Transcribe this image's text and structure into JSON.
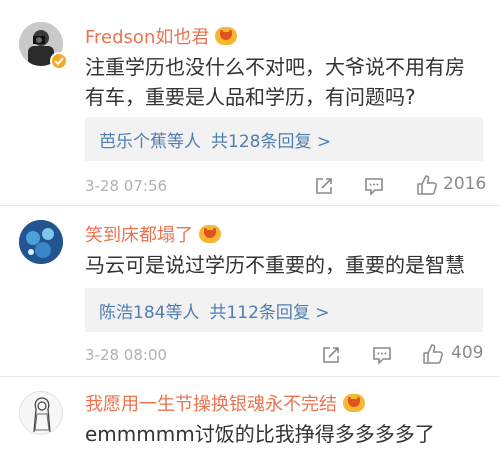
{
  "comments": [
    {
      "username": "Fredson如也君",
      "lines": [
        "注重学历也没什么不对吧，大爷说不用有房",
        "有车，重要是人品和学历，有问题吗?"
      ],
      "reply_names": "芭乐个蕉等人",
      "reply_count": "共128条回复 >",
      "time": "3-28 07:56",
      "likes": "2016",
      "verified": true
    },
    {
      "username": "笑到床都塌了",
      "lines": [
        "马云可是说过学历不重要的，重要的是智慧"
      ],
      "reply_names": "陈浩184等人",
      "reply_count": "共112条回复 >",
      "time": "3-28 08:00",
      "likes": "409",
      "verified": false
    },
    {
      "username": "我愿用一生节操换银魂永不完结",
      "lines": [
        "emmmmm讨饭的比我挣得多多多多了"
      ],
      "verified": false
    }
  ],
  "colors": {
    "username": "#eb7350",
    "link": "#507daf",
    "reply_bg": "#f2f2f2",
    "meta": "#b2b2b2"
  },
  "icons": [
    "share-icon",
    "comment-icon",
    "like-icon",
    "verified-icon",
    "vip-emoji-icon"
  ]
}
